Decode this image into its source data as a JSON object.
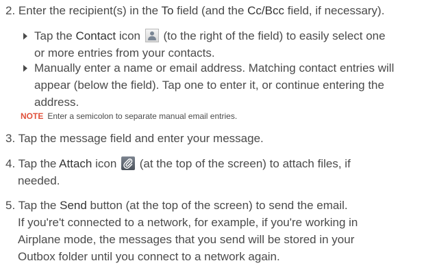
{
  "steps": [
    {
      "number": "2.",
      "parts": [
        "Enter the recipient(s) in the ",
        "To",
        " field (and the ",
        "Cc/Bcc",
        " field, if necessary)."
      ]
    },
    {
      "number": "3.",
      "text": "Tap the message field and enter your message."
    },
    {
      "number": "4.",
      "before": "Tap the ",
      "bold": "Attach",
      "mid": " icon ",
      "after_line1": " (at the top of the screen) to attach files, if",
      "line2": "needed."
    },
    {
      "number": "5.",
      "before": "Tap the ",
      "bold": "Send",
      "after": " button (at the top of the screen) to send the email.",
      "lines": [
        "If you're't connected to a network, for example, if you're working in",
        "Airplane mode, the messages that you send will be stored in your",
        "Outbox folder until you connect to a network again."
      ]
    }
  ],
  "bullets": [
    {
      "before": "Tap the ",
      "bold": "Contact",
      "mid": " icon ",
      "after_line1": " (to the right of the field) to easily select one",
      "line2": "or more entries from your contacts."
    },
    {
      "lines": [
        "Manually enter a name or email address. Matching contact entries will",
        "appear (below the field). Tap one to enter it, or continue entering the",
        "address."
      ]
    }
  ],
  "note": {
    "label": "NOTE",
    "text": "Enter a semicolon to separate manual email entries."
  },
  "icons": {
    "contact": "contact-icon",
    "attach": "paperclip-icon",
    "bullet": "right-triangle-bullet-icon"
  },
  "colors": {
    "body_text": "#4a4a4a",
    "note_label": "#e0503a"
  }
}
